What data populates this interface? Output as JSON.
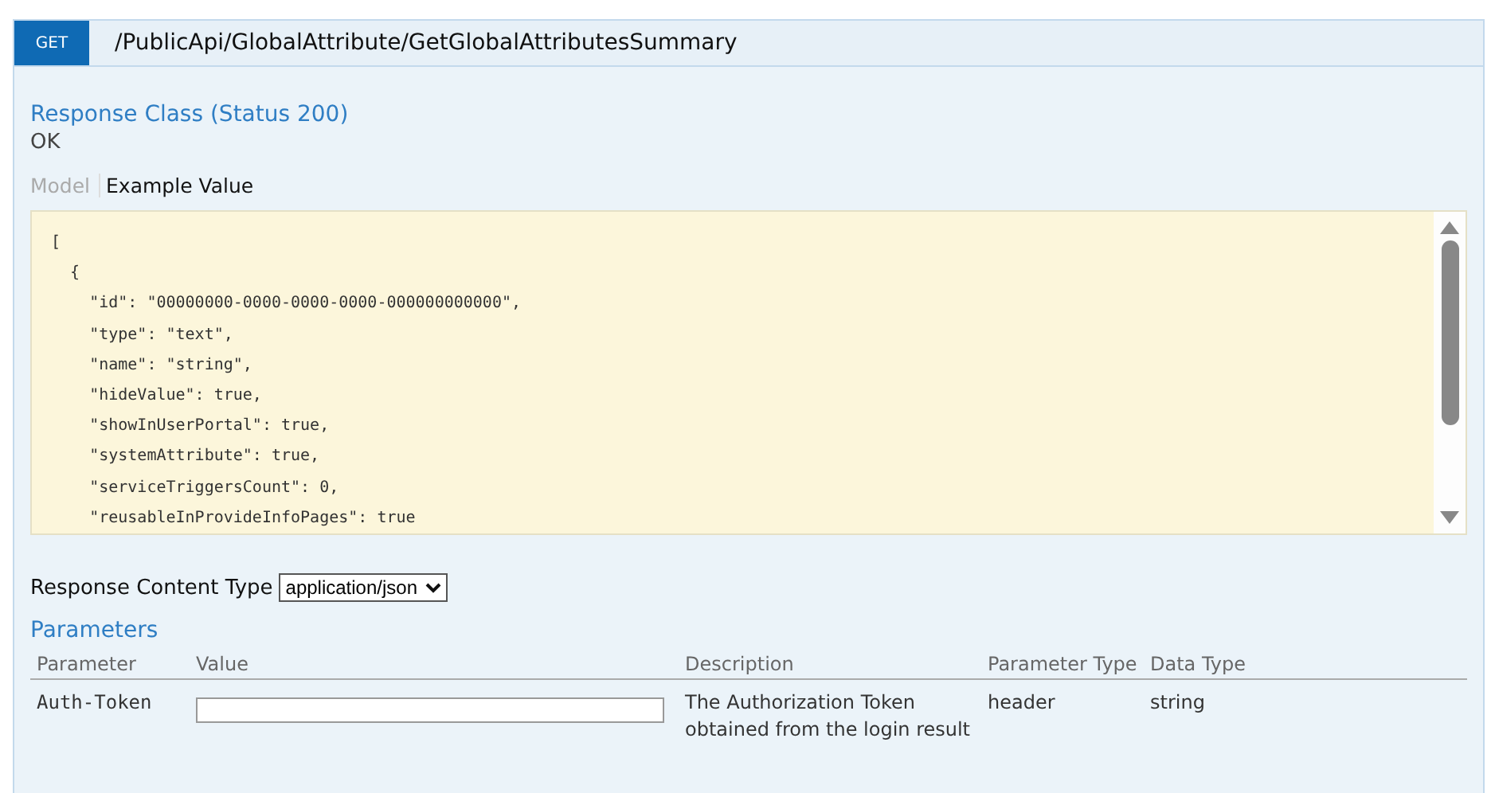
{
  "operation": {
    "method": "GET",
    "path": "/PublicApi/GlobalAttribute/GetGlobalAttributesSummary"
  },
  "response_class": {
    "title": "Response Class (Status 200)",
    "status_text": "OK"
  },
  "signature_tabs": [
    {
      "label": "Model",
      "selected": false
    },
    {
      "label": "Example Value",
      "selected": true
    }
  ],
  "example_value": [
    "[",
    "  {",
    "    \"id\": \"00000000-0000-0000-0000-000000000000\",",
    "    \"type\": \"text\",",
    "    \"name\": \"string\",",
    "    \"hideValue\": true,",
    "    \"showInUserPortal\": true,",
    "    \"systemAttribute\": true,",
    "    \"serviceTriggersCount\": 0,",
    "    \"reusableInProvideInfoPages\": true"
  ],
  "response_content_type": {
    "label": "Response Content Type",
    "value": "application/json"
  },
  "parameters": {
    "title": "Parameters",
    "columns": [
      "Parameter",
      "Value",
      "Description",
      "Parameter Type",
      "Data Type"
    ],
    "rows": [
      {
        "parameter": "Auth-Token",
        "description": "The Authorization Token obtained from the login result",
        "parameter_type": "header",
        "data_type": "string"
      }
    ]
  }
}
